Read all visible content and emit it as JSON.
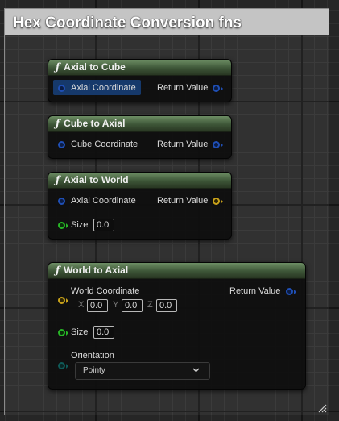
{
  "comment": {
    "title": "Hex Coordinate Conversion fns"
  },
  "nodes": {
    "axial_to_cube": {
      "title": "Axial to Cube",
      "input_label": "Axial Coordinate",
      "output_label": "Return Value"
    },
    "cube_to_axial": {
      "title": "Cube to Axial",
      "input_label": "Cube Coordinate",
      "output_label": "Return Value"
    },
    "axial_to_world": {
      "title": "Axial to World",
      "input_label": "Axial Coordinate",
      "output_label": "Return Value",
      "size_label": "Size",
      "size_value": "0.0"
    },
    "world_to_axial": {
      "title": "World to Axial",
      "input_label": "World Coordinate",
      "output_label": "Return Value",
      "x_label": "X",
      "x_value": "0.0",
      "y_label": "Y",
      "y_value": "0.0",
      "z_label": "Z",
      "z_value": "0.0",
      "size_label": "Size",
      "size_value": "0.0",
      "orientation_label": "Orientation",
      "orientation_value": "Pointy"
    }
  },
  "icons": {
    "function": "function-icon",
    "chevron": "chevron-down-icon",
    "grip": "resize-grip-icon"
  },
  "colors": {
    "struct_pin": "#1f4fb5",
    "vector_pin": "#c9a21a",
    "float_pin": "#27b526",
    "enum_pin": "#0f5a58",
    "node_header": "#4b6a44",
    "comment_title": "#c4c4c4"
  }
}
